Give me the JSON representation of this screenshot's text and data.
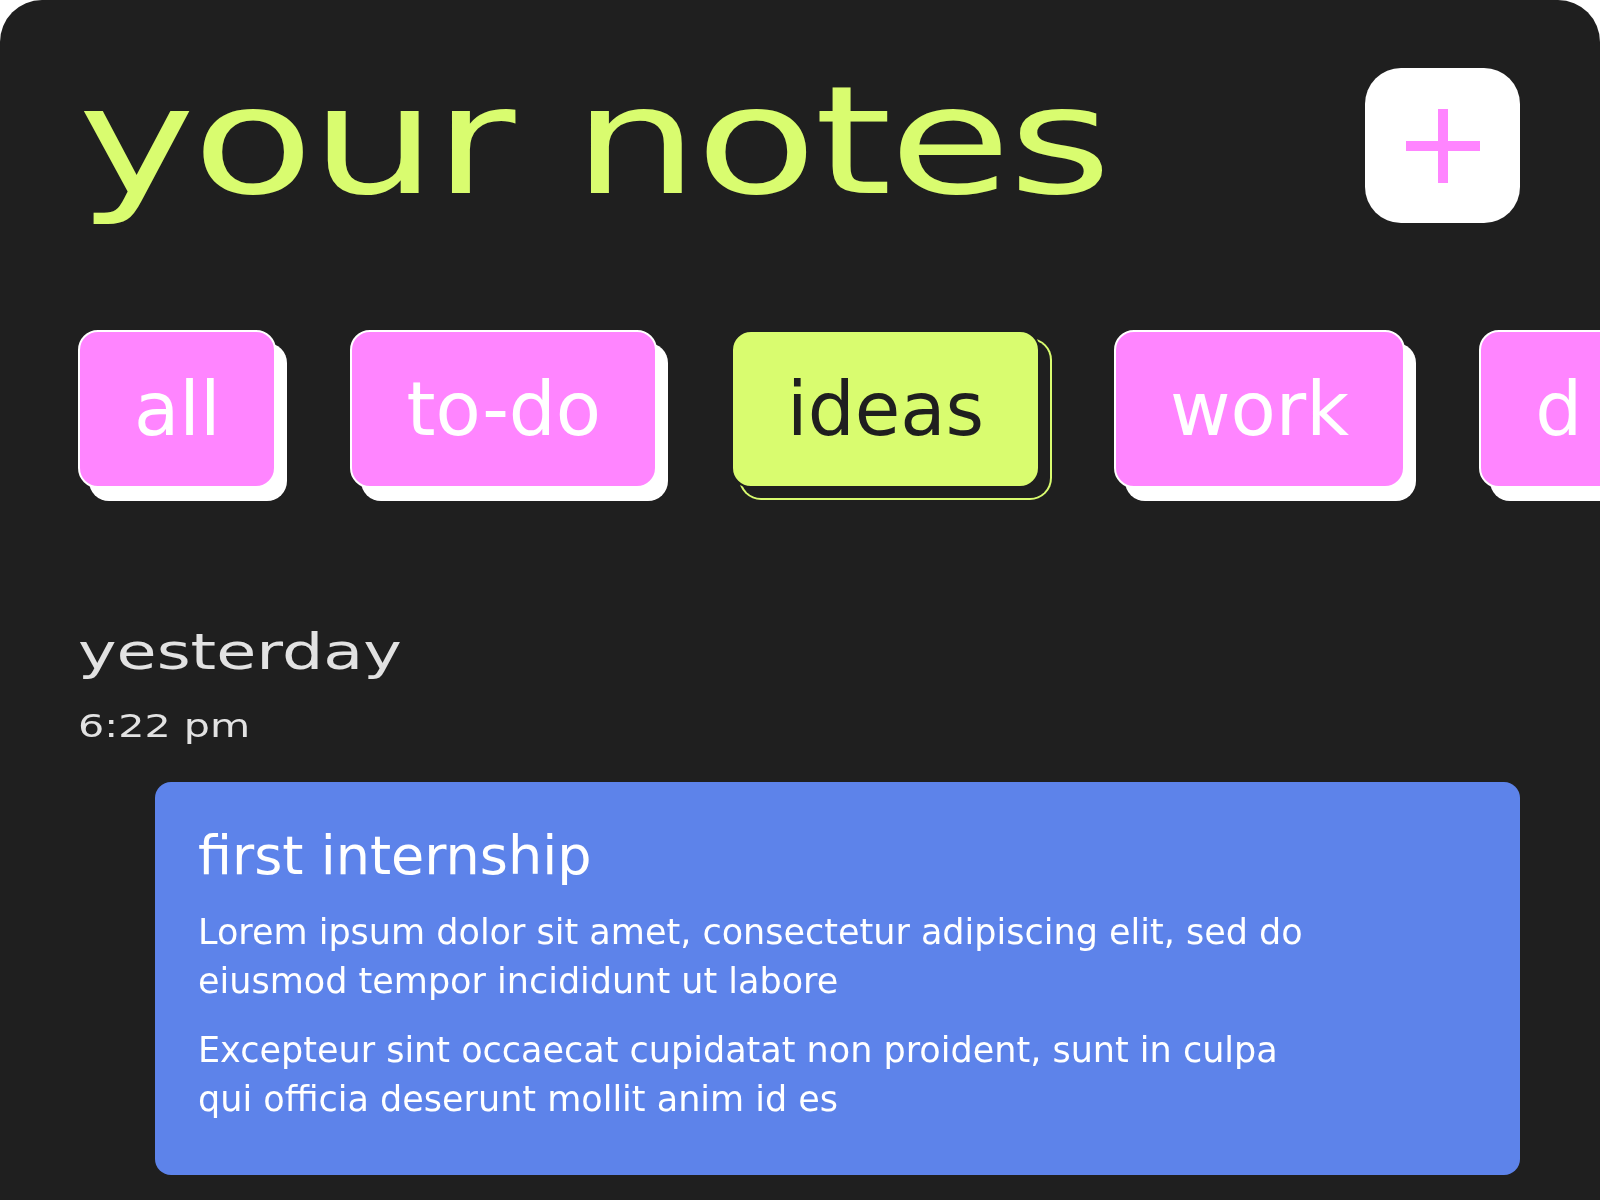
{
  "title": "your notes",
  "tabs": [
    {
      "label": "all",
      "selected": false
    },
    {
      "label": "to-do",
      "selected": false
    },
    {
      "label": "ideas",
      "selected": true
    },
    {
      "label": "work",
      "selected": false
    },
    {
      "label": "d",
      "selected": false
    }
  ],
  "sections": [
    {
      "heading": "yesterday",
      "notes": [
        {
          "time": "6:22 pm",
          "title": "first internship",
          "paragraphs": [
            "Lorem ipsum dolor sit amet, consectetur adipiscing elit, sed do eiusmod tempor incididunt ut labore",
            "Excepteur sint occaecat cupidatat non proident, sunt in culpa qui officia deserunt mollit anim id es"
          ]
        }
      ]
    }
  ]
}
